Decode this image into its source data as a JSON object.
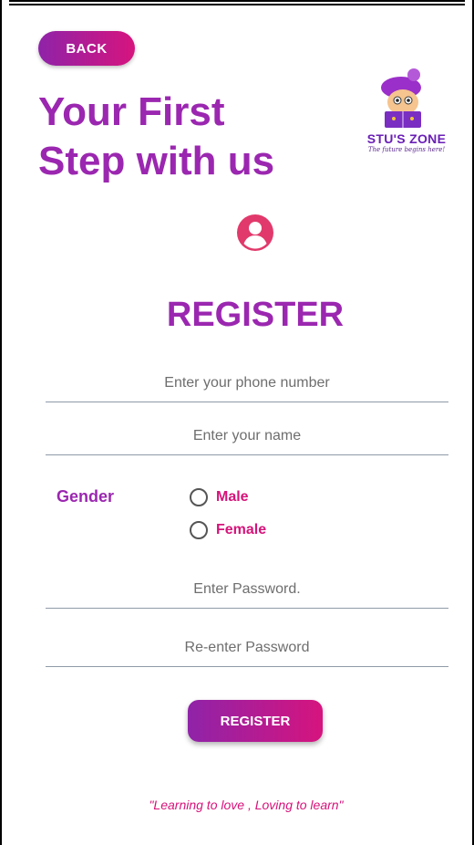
{
  "header": {
    "back_label": "BACK",
    "headline_line1": "Your First",
    "headline_line2": "Step with us"
  },
  "logo": {
    "brand": "STU'S ZONE",
    "tagline": "The future begins here!"
  },
  "form": {
    "title": "REGISTER",
    "phone_placeholder": "Enter your phone number",
    "name_placeholder": "Enter your name",
    "gender_label": "Gender",
    "gender_options": [
      "Male",
      "Female"
    ],
    "password_placeholder": "Enter Password.",
    "reenter_password_placeholder": "Re-enter Password",
    "submit_label": "REGISTER"
  },
  "footer": {
    "quote": "\"Learning to love , Loving to learn\""
  },
  "icons": {
    "user": "account-circle-icon",
    "radio": "radio-unchecked-icon"
  },
  "colors": {
    "primary_purple": "#9b27b0",
    "accent_pink": "#d6137a",
    "gradient_start": "#8f23a8",
    "gradient_end": "#d6147e",
    "user_icon": "#e1396b"
  }
}
